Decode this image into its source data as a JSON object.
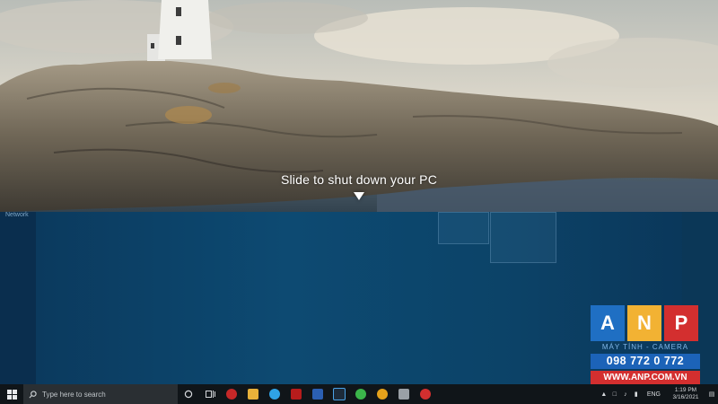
{
  "lock_screen": {
    "prompt_text": "Slide to shut down your PC"
  },
  "desktop": {
    "corner_label": "Network"
  },
  "watermark": {
    "letters": [
      "A",
      "N",
      "P"
    ],
    "letter_colors": [
      "#1f6fc3",
      "#f2b233",
      "#d32f2f"
    ],
    "subtitle": "MÁY TÍNH - CAMERA",
    "phone": "098 772 0 772",
    "website": "WWW.ANP.COM.VN"
  },
  "taskbar": {
    "search_placeholder": "Type here to search",
    "apps": [
      {
        "name": "task-view-icon",
        "color": "#cfd3d6"
      },
      {
        "name": "app-red-icon",
        "color": "#c62828"
      },
      {
        "name": "file-explorer-icon",
        "color": "#e8b13a"
      },
      {
        "name": "edge-icon",
        "color": "#2fa3e6"
      },
      {
        "name": "app-red2-icon",
        "color": "#b71c1c"
      },
      {
        "name": "word-icon",
        "color": "#2b5fb3"
      },
      {
        "name": "photoshop-icon",
        "color": "#1d2b3a"
      },
      {
        "name": "line-icon",
        "color": "#3bb54a"
      },
      {
        "name": "chrome-icon",
        "color": "#e5a21b"
      },
      {
        "name": "app-gray-icon",
        "color": "#9aa0a6"
      },
      {
        "name": "app-red3-icon",
        "color": "#d32f2f"
      }
    ],
    "tray": {
      "language": "ENG",
      "time": "1:19 PM",
      "date": "3/16/2021"
    }
  },
  "colors": {
    "taskbar_bg": "#101519",
    "desktop_blue": "#0d4a72"
  }
}
